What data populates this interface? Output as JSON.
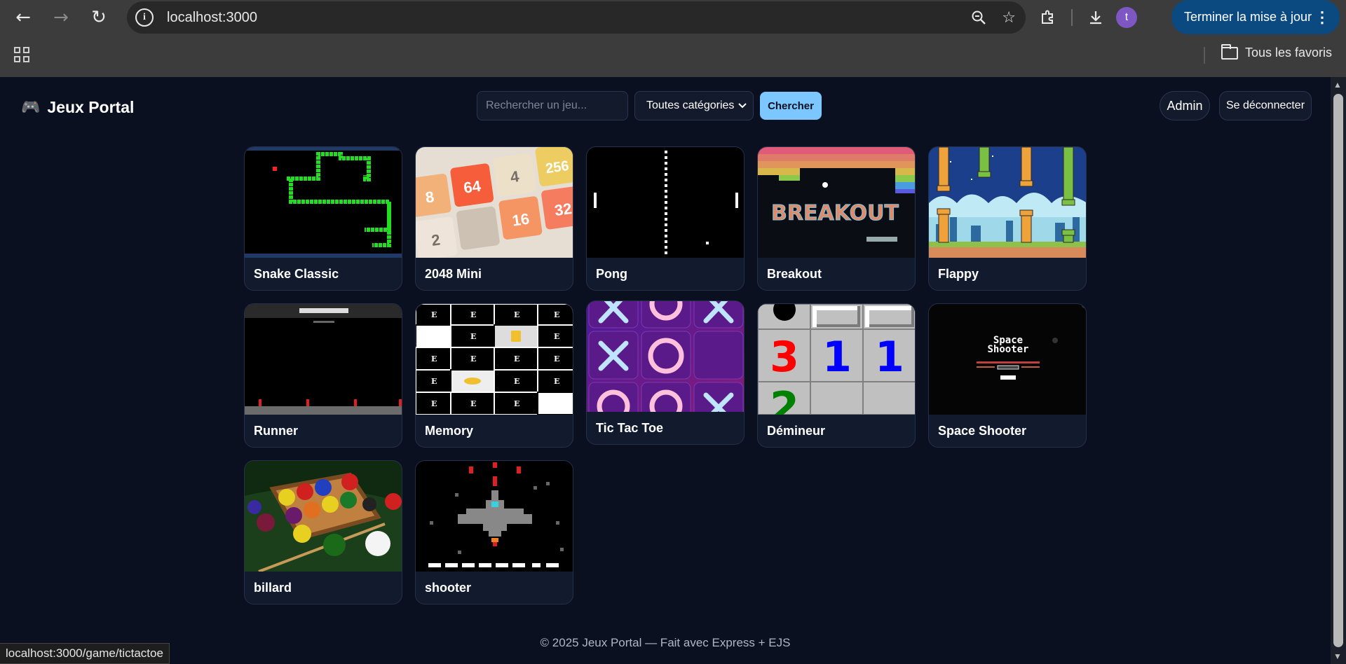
{
  "browser": {
    "url": "localhost:3000",
    "update_button": "Terminer la mise à jour",
    "profile_initial": "t",
    "bookmarks_folder": "Tous les favoris",
    "status_url": "localhost:3000/game/tictactoe"
  },
  "header": {
    "logo_icon": "🎮",
    "logo_text": "Jeux Portal",
    "search_placeholder": "Rechercher un jeu...",
    "category_selected": "Toutes catégories",
    "search_button": "Chercher",
    "admin_button": "Admin",
    "logout_button": "Se déconnecter"
  },
  "games": [
    {
      "title": "Snake Classic"
    },
    {
      "title": "2048 Mini"
    },
    {
      "title": "Pong"
    },
    {
      "title": "Breakout"
    },
    {
      "title": "Flappy"
    },
    {
      "title": "Runner"
    },
    {
      "title": "Memory"
    },
    {
      "title": "Tic Tac Toe"
    },
    {
      "title": "Démineur"
    },
    {
      "title": "Space Shooter"
    },
    {
      "title": "billard"
    },
    {
      "title": "shooter"
    }
  ],
  "thumb_text": {
    "tiles_2048": [
      "8",
      "64",
      "4",
      "256",
      "2",
      "",
      "16",
      "32"
    ],
    "breakout_logo": "BREAKOUT",
    "mine_numbers": [
      "3",
      "1",
      "1",
      "2"
    ],
    "space_title_1": "Space",
    "space_title_2": "Shooter"
  },
  "footer": "© 2025 Jeux Portal — Fait avec Express + EJS",
  "colors": {
    "page_bg": "#0b1020",
    "card_bg": "#121a2d",
    "accent": "#7cc7ff",
    "chrome_bg": "#3c3c3c",
    "update_btn": "#0b4a80"
  }
}
